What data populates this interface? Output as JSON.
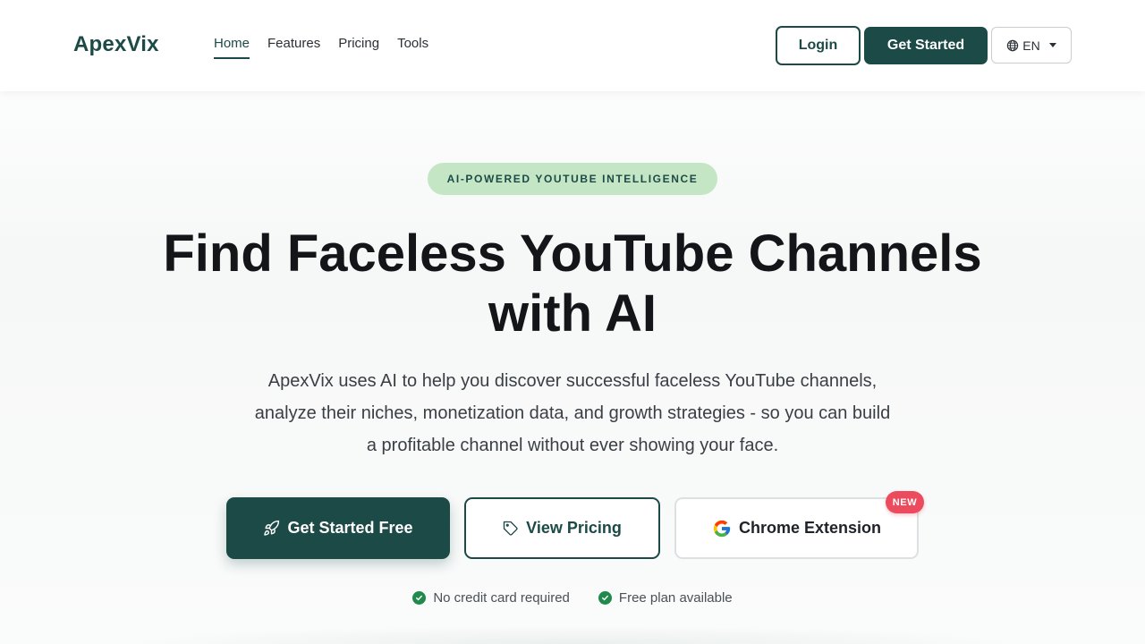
{
  "nav": {
    "brand": "ApexVix",
    "links": [
      {
        "label": "Home"
      },
      {
        "label": "Features"
      },
      {
        "label": "Pricing"
      },
      {
        "label": "Tools"
      }
    ],
    "login_label": "Login",
    "get_started_label": "Get Started",
    "language": "EN"
  },
  "hero": {
    "badge": "AI-POWERED YOUTUBE INTELLIGENCE",
    "title_line1": "Find Faceless YouTube Channels",
    "title_line2": "with AI",
    "subtitle": "ApexVix uses AI to help you discover successful faceless YouTube channels, analyze their niches, monetization data, and growth strategies - so you can build a profitable channel without ever showing your face.",
    "cta_primary": "Get Started Free",
    "cta_secondary": "View Pricing",
    "cta_chrome": "Chrome Extension",
    "new_badge": "NEW",
    "checks": [
      {
        "label": "No credit card required"
      },
      {
        "label": "Free plan available"
      }
    ]
  },
  "icons": {
    "rocket": "rocket-icon",
    "tag": "tag-icon",
    "google": "google-icon",
    "globe": "globe-icon",
    "check": "check-circle-icon"
  },
  "colors": {
    "primary": "#1c4a47",
    "badge_bg": "#c4e6c4",
    "new_badge": "#ec4b5e",
    "check_green": "#1f8a4c"
  }
}
